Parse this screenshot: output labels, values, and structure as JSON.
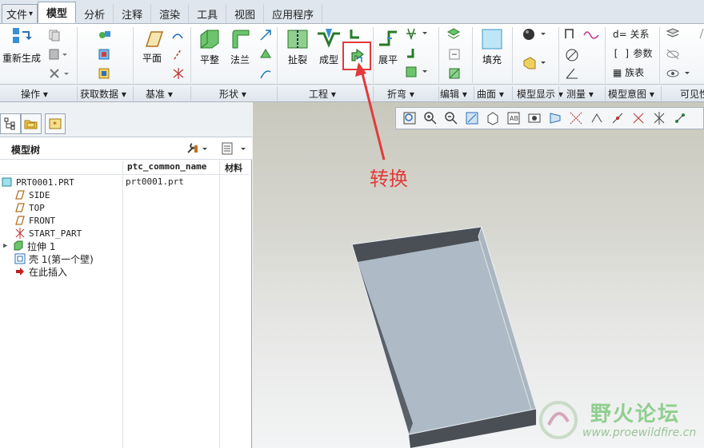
{
  "menu": {
    "tabs": [
      "文件",
      "模型",
      "分析",
      "注释",
      "渲染",
      "工具",
      "视图",
      "应用程序"
    ],
    "file_arrow": "▾",
    "active_tab": "模型"
  },
  "ribbon": {
    "buttons": {
      "regen": "重新生成",
      "plane": "平面",
      "flat": "平整",
      "flange": "法兰",
      "rip": "扯裂",
      "form": "成型",
      "unbend": "展平",
      "fill": "填充"
    },
    "relations": "d= 关系",
    "params": "参数",
    "family": "族表"
  },
  "groups": [
    {
      "label": "操作"
    },
    {
      "label": "获取数据"
    },
    {
      "label": "基准"
    },
    {
      "label": "形状"
    },
    {
      "label": "工程"
    },
    {
      "label": "折弯"
    },
    {
      "label": "编辑"
    },
    {
      "label": "曲面"
    },
    {
      "label": "模型显示"
    },
    {
      "label": "测量"
    },
    {
      "label": "模型意图"
    },
    {
      "label": "可见性"
    }
  ],
  "tree": {
    "title": "模型树",
    "columns": [
      "ptc_common_name",
      "材料"
    ],
    "items": [
      {
        "label": "PRT0001.PRT",
        "common_name": "prt0001.prt"
      },
      {
        "label": "SIDE"
      },
      {
        "label": "TOP"
      },
      {
        "label": "FRONT"
      },
      {
        "label": "START_PART"
      },
      {
        "label": "拉伸 1",
        "expander": "▶"
      },
      {
        "label": "壳 1(第一个壁)"
      },
      {
        "label": "在此插入"
      }
    ]
  },
  "annotation": {
    "text": "转换",
    "color": "#e23a3a"
  },
  "watermark": {
    "title": "野火论坛",
    "url": "www.proewildfire.cn"
  },
  "colors": {
    "accent_red": "#e23a3a",
    "plate_top": "#aebbc6",
    "plate_side": "#4a4f55"
  }
}
